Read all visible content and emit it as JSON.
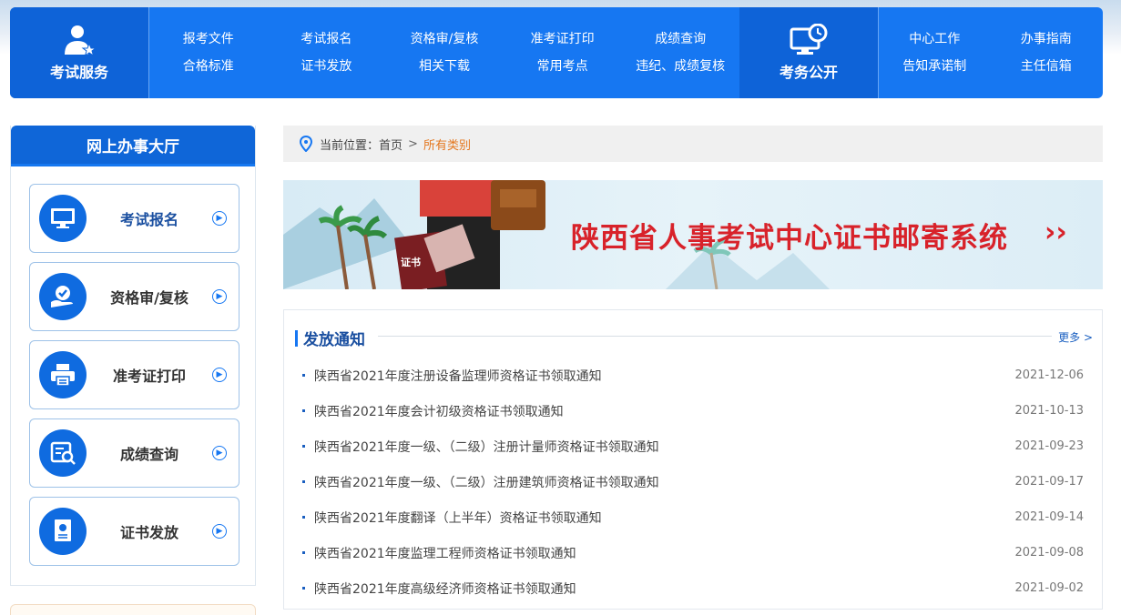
{
  "nav": {
    "service_label": "考试服务",
    "columns": [
      [
        "报考文件",
        "合格标准"
      ],
      [
        "考试报名",
        "证书发放"
      ],
      [
        "资格审/复核",
        "相关下载"
      ],
      [
        "准考证打印",
        "常用考点"
      ],
      [
        "成绩查询",
        "违纪、成绩复核"
      ]
    ],
    "public_label": "考务公开",
    "right_columns": [
      [
        "中心工作",
        "告知承诺制"
      ],
      [
        "办事指南",
        "主任信箱"
      ]
    ]
  },
  "sidebar": {
    "title": "网上办事大厅",
    "items": [
      {
        "label": "考试报名",
        "icon": "monitor-icon"
      },
      {
        "label": "资格审/复核",
        "icon": "check-hand-icon"
      },
      {
        "label": "准考证打印",
        "icon": "printer-icon"
      },
      {
        "label": "成绩查询",
        "icon": "score-search-icon"
      },
      {
        "label": "证书发放",
        "icon": "certificate-icon"
      }
    ]
  },
  "breadcrumb": {
    "prefix": "当前位置：",
    "home": "首页",
    "separator": ">",
    "current": "所有类别"
  },
  "banner": {
    "title": "陕西省人事考试中心证书邮寄系统",
    "arrows": "››",
    "cert_label": "证书"
  },
  "notice": {
    "title": "发放通知",
    "more": "更多 >",
    "items": [
      {
        "title": "陕西省2021年度注册设备监理师资格证书领取通知",
        "date": "2021-12-06"
      },
      {
        "title": "陕西省2021年度会计初级资格证书领取通知",
        "date": "2021-10-13"
      },
      {
        "title": "陕西省2021年度一级、（二级）注册计量师资格证书领取通知",
        "date": "2021-09-23"
      },
      {
        "title": "陕西省2021年度一级、（二级）注册建筑师资格证书领取通知",
        "date": "2021-09-17"
      },
      {
        "title": "陕西省2021年度翻译（上半年）资格证书领取通知",
        "date": "2021-09-14"
      },
      {
        "title": "陕西省2021年度监理工程师资格证书领取通知",
        "date": "2021-09-08"
      },
      {
        "title": "陕西省2021年度高级经济师资格证书领取通知",
        "date": "2021-09-02"
      }
    ]
  },
  "colors": {
    "nav_blue": "#1677f2",
    "nav_dark": "#0e63d8",
    "banner_red": "#d8222a",
    "breadcrumb_orange": "#e4771f"
  }
}
